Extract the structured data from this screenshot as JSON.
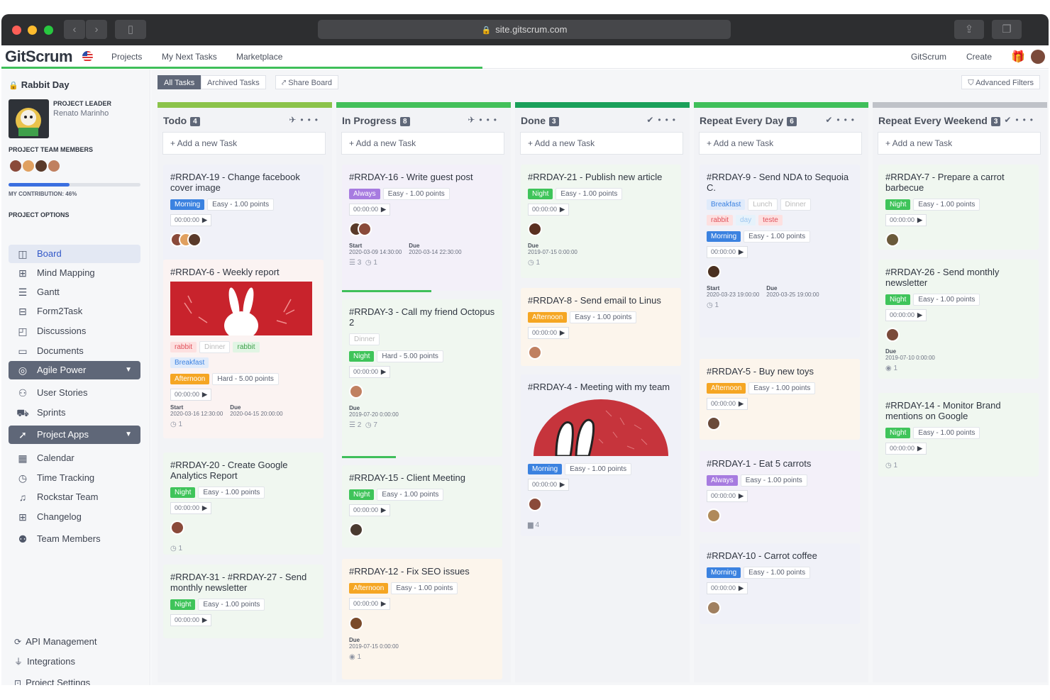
{
  "browser": {
    "url": "site.gitscrum.com"
  },
  "nav": {
    "logo": "GitScrum",
    "links": [
      "Projects",
      "My Next Tasks",
      "Marketplace"
    ],
    "right": [
      "GitScrum",
      "Create"
    ]
  },
  "sidebar": {
    "project": "Rabbit Day",
    "leader_label": "PROJECT LEADER",
    "leader_name": "Renato Marinho",
    "team_label": "PROJECT TEAM MEMBERS",
    "contribution": "MY CONTRIBUTION: 46%",
    "contribution_value": 0.46,
    "options_label": "PROJECT OPTIONS",
    "menu": [
      "Board",
      "Mind Mapping",
      "Gantt",
      "Form2Task",
      "Discussions",
      "Documents",
      "Agile Power",
      "User Stories",
      "Sprints",
      "Project Apps",
      "Calendar",
      "Time Tracking",
      "Rockstar Team",
      "Changelog",
      "Team Members"
    ],
    "bottom": [
      "API Management",
      "Integrations",
      "Project Settings"
    ]
  },
  "board": {
    "tabs": [
      "All Tasks",
      "Archived Tasks",
      "Share Board"
    ],
    "advanced": "Advanced Filters",
    "add_task": "+ Add a new Task",
    "columns": [
      {
        "title": "Todo",
        "count": "4",
        "color": "#8bc34a"
      },
      {
        "title": "In Progress",
        "count": "8",
        "color": "#43c05a"
      },
      {
        "title": "Done",
        "count": "3",
        "color": "#1aa05a"
      },
      {
        "title": "Repeat Every Day",
        "count": "6",
        "color": "#3fbf5a"
      },
      {
        "title": "Repeat Every Weekend",
        "count": "3",
        "color": "#bfc2c8"
      }
    ]
  },
  "cards": {
    "c19": {
      "title": "#RRDAY-19 - Change facebook cover image",
      "tag": "Morning",
      "diff": "Easy - 1.00 points",
      "timer": "00:00:00"
    },
    "c6": {
      "title": "#RRDAY-6 - Weekly report",
      "tags": [
        "rabbit",
        "Dinner",
        "rabbit",
        "Breakfast"
      ],
      "tag": "Afternoon",
      "diff": "Hard - 5.00 points",
      "timer": "00:00:00",
      "start_label": "Start",
      "start": "2020-03-16 12:30:00",
      "due_label": "Due",
      "due": "2020-04-15 20:00:00",
      "count": "1"
    },
    "c20": {
      "title": "#RRDAY-20 - Create Google Analytics Report",
      "tag": "Night",
      "diff": "Easy - 1.00 points",
      "timer": "00:00:00",
      "count": "1"
    },
    "c31": {
      "title": "#RRDAY-31 - #RRDAY-27 - Send monthly newsletter",
      "tag": "Night",
      "diff": "Easy - 1.00 points",
      "timer": "00:00:00"
    },
    "c16": {
      "title": "#RRDAY-16 - Write guest post",
      "tag": "Always",
      "diff": "Easy - 1.00 points",
      "timer": "00:00:00",
      "start_label": "Start",
      "start": "2020-03-09 14:30:00",
      "due_label": "Due",
      "due": "2020-03-14 22:30:00",
      "count_a": "3",
      "count_b": "1"
    },
    "c3": {
      "title": "#RRDAY-3 - Call my friend Octopus 2",
      "pre": "Dinner",
      "tag": "Night",
      "diff": "Hard - 5.00 points",
      "timer": "00:00:00",
      "due_label": "Due",
      "due": "2019-07-20 0:00:00",
      "count_a": "2",
      "count_b": "7"
    },
    "c15": {
      "title": "#RRDAY-15 - Client Meeting",
      "tag": "Night",
      "diff": "Easy - 1.00 points",
      "timer": "00:00:00"
    },
    "c12": {
      "title": "#RRDAY-12 - Fix SEO issues",
      "tag": "Afternoon",
      "diff": "Easy - 1.00 points",
      "timer": "00:00:00",
      "due_label": "Due",
      "due": "2019-07-15 0:00:00",
      "count": "1"
    },
    "c21": {
      "title": "#RRDAY-21 - Publish new article",
      "tag": "Night",
      "diff": "Easy - 1.00 points",
      "timer": "00:00:00",
      "due_label": "Due",
      "due": "2019-07-15 0:00:00",
      "count": "1"
    },
    "c8": {
      "title": "#RRDAY-8 - Send email to Linus",
      "tag": "Afternoon",
      "diff": "Easy - 1.00 points",
      "timer": "00:00:00"
    },
    "c4": {
      "title": "#RRDAY-4 - Meeting with my team",
      "tag": "Morning",
      "diff": "Easy - 1.00 points",
      "timer": "00:00:00",
      "count": "4"
    },
    "c9": {
      "title": "#RRDAY-9 - Send NDA to Sequoia C.",
      "tags": [
        "Breakfast",
        "Lunch",
        "Dinner",
        "rabbit",
        "day",
        "teste"
      ],
      "tag": "Morning",
      "diff": "Easy - 1.00 points",
      "timer": "00:00:00",
      "start_label": "Start",
      "start": "2020-03-23 19:00:00",
      "due_label": "Due",
      "due": "2020-03-25 19:00:00",
      "count": "1"
    },
    "c5": {
      "title": "#RRDAY-5 - Buy new toys",
      "tag": "Afternoon",
      "diff": "Easy - 1.00 points",
      "timer": "00:00:00"
    },
    "c1": {
      "title": "#RRDAY-1 - Eat 5 carrots",
      "tag": "Always",
      "diff": "Easy - 1.00 points",
      "timer": "00:00:00"
    },
    "c10": {
      "title": "#RRDAY-10 - Carrot coffee",
      "tag": "Morning",
      "diff": "Easy - 1.00 points",
      "timer": "00:00:00"
    },
    "c7": {
      "title": "#RRDAY-7 - Prepare a carrot barbecue",
      "tag": "Night",
      "diff": "Easy - 1.00 points",
      "timer": "00:00:00"
    },
    "c26": {
      "title": "#RRDAY-26 - Send monthly newsletter",
      "tag": "Night",
      "diff": "Easy - 1.00 points",
      "timer": "00:00:00",
      "due_label": "Due",
      "due": "2019-07-10 0:00:00",
      "count": "1"
    },
    "c14": {
      "title": "#RRDAY-14 - Monitor Brand mentions on Google",
      "tag": "Night",
      "diff": "Easy - 1.00 points",
      "timer": "00:00:00",
      "count": "1"
    }
  },
  "colors": {
    "morning": "#3b82e0",
    "night": "#3fc45a",
    "afternoon": "#f5a623",
    "always": "#a77be0",
    "rabbit": "#e0505a",
    "breakfast": "#4a8ae0"
  }
}
